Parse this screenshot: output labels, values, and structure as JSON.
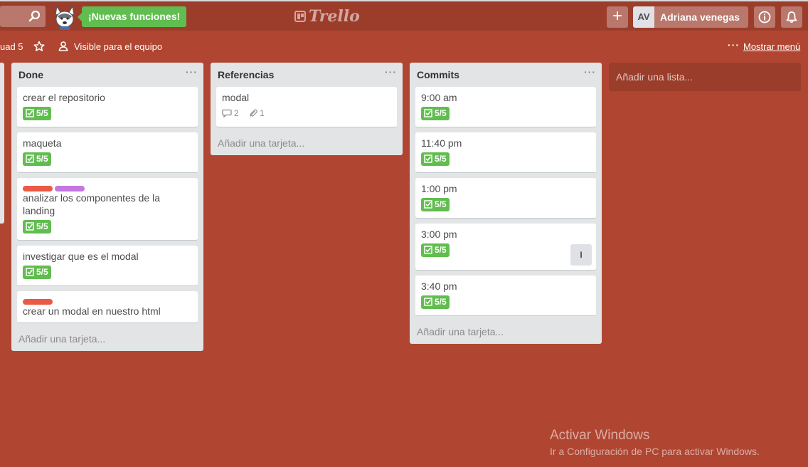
{
  "header": {
    "new_features": "¡Nuevas funciones!",
    "logo_text": "Trello",
    "add_label": "+",
    "avatar_initials": "AV",
    "user_name": "Adriana venegas"
  },
  "board": {
    "name_fragment": "uad 5",
    "visibility_label": "Visible para el equipo",
    "menu_dots": "···",
    "show_menu_label": "Mostrar menú"
  },
  "lists": [
    {
      "title": "Done",
      "menu": "···",
      "add_card": "Añadir una tarjeta...",
      "cards": [
        {
          "title": "crear el repositorio",
          "checklist": "5/5"
        },
        {
          "title": "maqueta",
          "checklist": "5/5"
        },
        {
          "title": "analizar los componentes de la landing",
          "checklist": "5/5",
          "labels": [
            "#eb5a46",
            "#c377e0"
          ]
        },
        {
          "title": "investigar que es el modal",
          "checklist": "5/5"
        },
        {
          "title": "crear un modal en nuestro html",
          "labels": [
            "#eb5a46"
          ]
        }
      ]
    },
    {
      "title": "Referencias",
      "menu": "···",
      "add_card": "Añadir una tarjeta...",
      "cards": [
        {
          "title": "modal",
          "comments": "2",
          "attachments": "1"
        }
      ]
    },
    {
      "title": "Commits",
      "menu": "···",
      "add_card": "Añadir una tarjeta...",
      "cards": [
        {
          "title": "9:00 am",
          "checklist": "5/5"
        },
        {
          "title": "11:40 pm",
          "checklist": "5/5"
        },
        {
          "title": "1:00 pm",
          "checklist": "5/5"
        },
        {
          "title": "3:00 pm",
          "checklist": "5/5",
          "member": "I"
        },
        {
          "title": "3:40 pm",
          "checklist": "5/5"
        }
      ]
    }
  ],
  "add_list": "Añadir una lista...",
  "watermark": {
    "title": "Activar Windows",
    "subtitle": "Ir a Configuración de PC para activar Windows."
  },
  "colors": {
    "board_bg": "#b04632",
    "header_bg": "#9c3d2c",
    "green_badge": "#61bd4f",
    "label_red": "#eb5a46",
    "label_purple": "#c377e0"
  },
  "icons": [
    "search-icon",
    "husky-mascot-icon",
    "trello-logo-icon",
    "plus-icon",
    "info-icon",
    "bell-icon",
    "star-icon",
    "team-visibility-icon",
    "checklist-icon",
    "comment-icon",
    "attachment-icon"
  ]
}
